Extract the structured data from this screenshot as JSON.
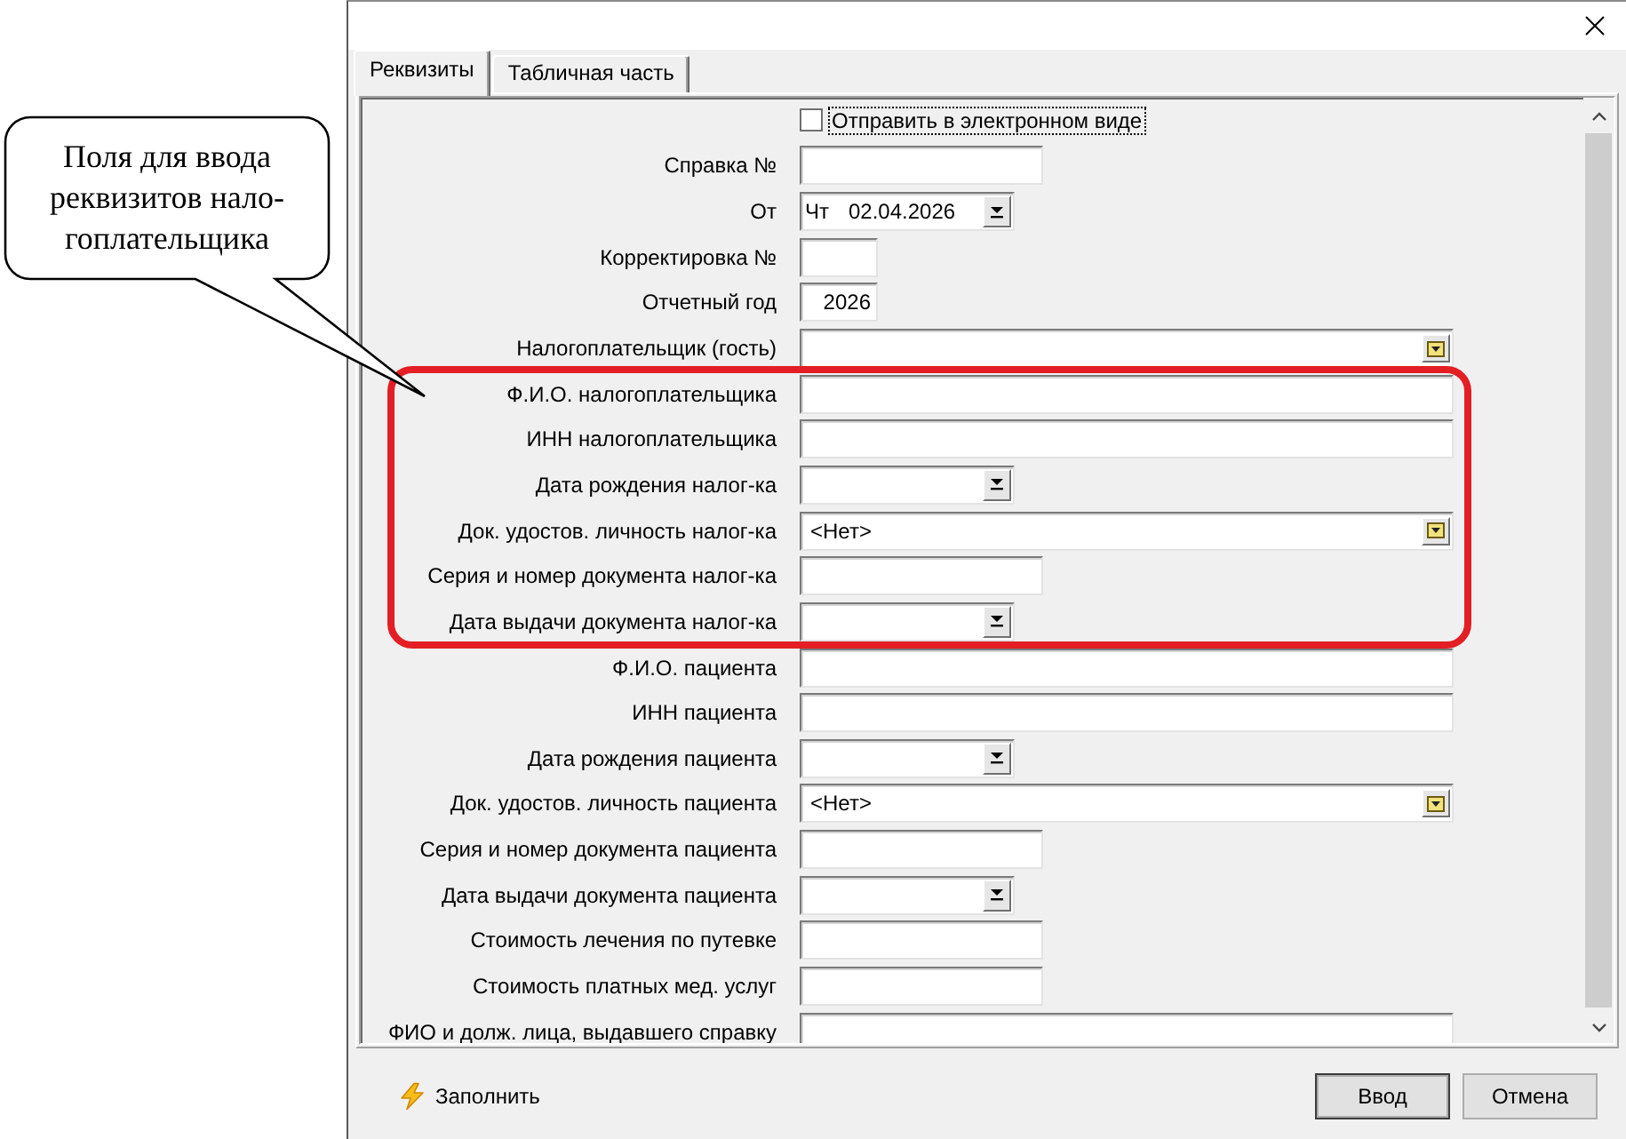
{
  "callout": {
    "lines": [
      "Поля для ввода",
      "реквизитов нало-",
      "гоплательщика"
    ]
  },
  "tabs": [
    {
      "label": "Реквизиты",
      "selected": true
    },
    {
      "label": "Табличная часть",
      "selected": false
    }
  ],
  "form": {
    "sections": [
      {
        "kind": "plain",
        "rows": [
          {
            "kind": "checkbox",
            "label": "Отправить в электронном виде",
            "checked": false,
            "focused": true
          },
          {
            "kind": "text",
            "label": "Справка №"
          },
          {
            "kind": "date",
            "label": "От",
            "weekday": "Чт",
            "value": "02.04.2026"
          },
          {
            "kind": "short",
            "label": "Корректировка №"
          },
          {
            "kind": "short",
            "label": "Отчетный год",
            "value": "2026"
          },
          {
            "kind": "lookup",
            "label": "Налогоплательщик (гость)"
          }
        ]
      },
      {
        "kind": "framed",
        "rows": [
          {
            "kind": "wide",
            "label": "Ф.И.О. налогоплательщика"
          },
          {
            "kind": "wide",
            "label": "ИНН налогоплательщика"
          },
          {
            "kind": "date",
            "label": "Дата рождения налог-ка"
          },
          {
            "kind": "lookup",
            "label": "Док. удостов. личность налог-ка",
            "value": "<Нет>"
          },
          {
            "kind": "text",
            "label": "Серия и номер документа налог-ка"
          },
          {
            "kind": "date",
            "label": "Дата выдачи документа налог-ка"
          }
        ]
      },
      {
        "kind": "plain",
        "rows": [
          {
            "kind": "wide",
            "label": "Ф.И.О. пациента"
          },
          {
            "kind": "wide",
            "label": "ИНН пациента"
          },
          {
            "kind": "date",
            "label": "Дата рождения пациента"
          },
          {
            "kind": "lookup",
            "label": "Док. удостов. личность пациента",
            "value": "<Нет>"
          },
          {
            "kind": "text",
            "label": "Серия и номер документа пациента"
          },
          {
            "kind": "date",
            "label": "Дата выдачи документа пациента"
          },
          {
            "kind": "text",
            "label": "Стоимость лечения по путевке"
          },
          {
            "kind": "text",
            "label": "Стоимость платных мед. услуг"
          },
          {
            "kind": "wide",
            "label": "ФИО и долж. лица, выдавшего справку"
          }
        ]
      }
    ]
  },
  "footer": {
    "fill_button": "Заполнить",
    "buttons": [
      {
        "label": "Ввод",
        "default": true
      },
      {
        "label": "Отмена",
        "default": false
      }
    ]
  }
}
